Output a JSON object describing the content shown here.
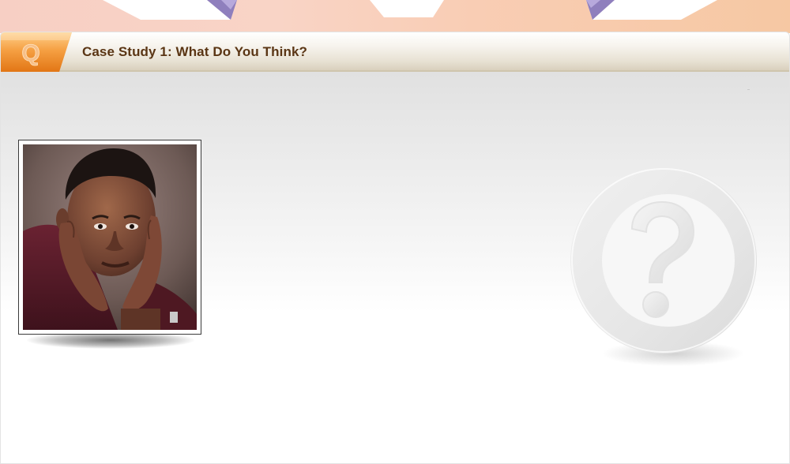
{
  "header": {
    "badge_letter": "Q",
    "title": "Case Study 1: What Do You Think?"
  },
  "photo": {
    "icon": "person-thinking-photo"
  },
  "emblem": {
    "icon": "question-mark-icon"
  },
  "colors": {
    "title_text": "#5a3514",
    "badge_orange": "#f28c28",
    "tab_purple": "#8a7bb8"
  }
}
